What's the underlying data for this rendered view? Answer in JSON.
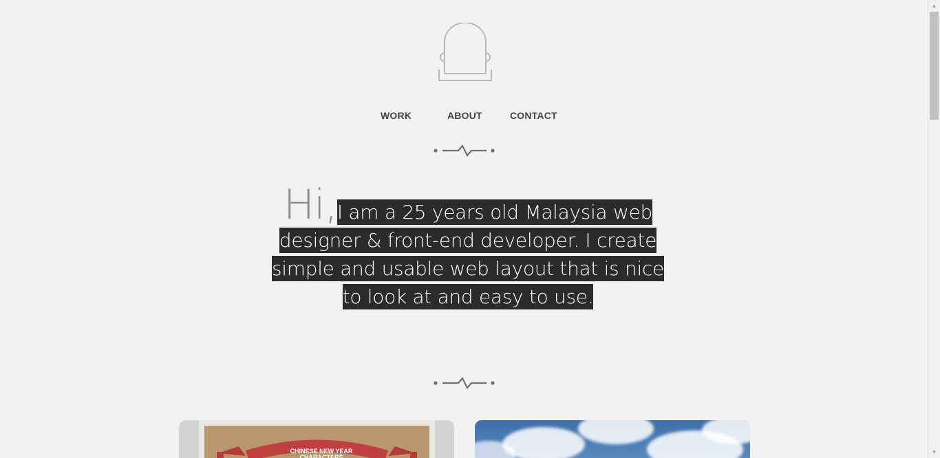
{
  "nav": {
    "work": "WORK",
    "about": "ABOUT",
    "contact": "CONTACT"
  },
  "intro": {
    "greeting": "Hi,",
    "text": "I am a 25 years old Malaysia web designer & front-end developer. I create simple and usable web layout that is nice to look at and easy to use."
  },
  "portfolio": {
    "items": [
      {
        "banner": "CHINESE NEW YEAR CHARACTERS"
      },
      {
        "banner": ""
      }
    ]
  },
  "icons": {
    "logo": "tombstone-logo-icon",
    "divider": "heartbeat-divider-icon"
  },
  "colors": {
    "background": "#f2f2f2",
    "highlight": "#2b2b2b",
    "nav_text": "#444444",
    "greeting": "#8c8c8c"
  }
}
